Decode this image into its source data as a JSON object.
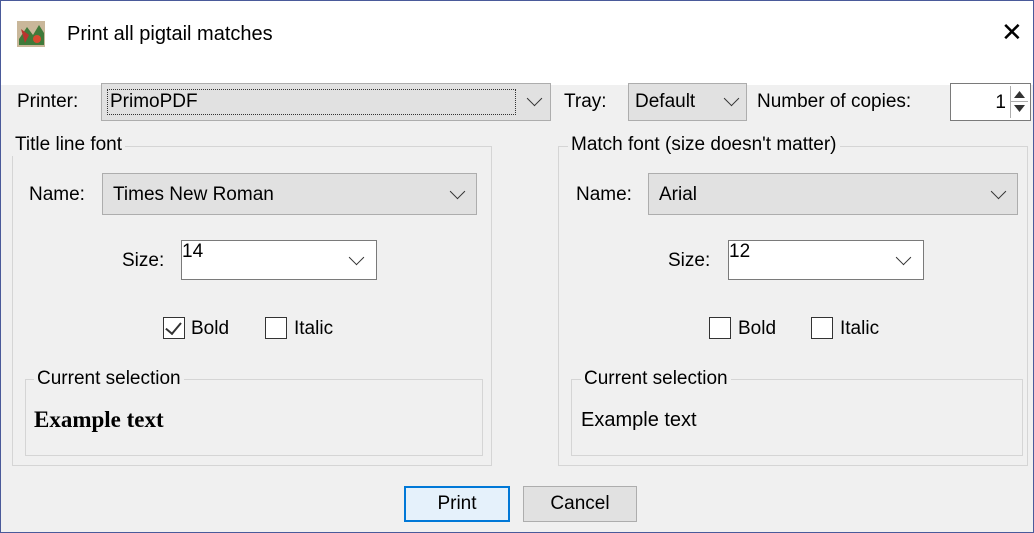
{
  "window": {
    "title": "Print all pigtail matches"
  },
  "printer": {
    "label": "Printer:",
    "value": "PrimoPDF",
    "tray_label": "Tray:",
    "tray_value": "Default",
    "copies_label": "Number of copies:",
    "copies_value": "1"
  },
  "title_font": {
    "legend": "Title line font",
    "name_label": "Name:",
    "name_value": "Times New Roman",
    "size_label": "Size:",
    "size_value": "14",
    "bold_label": "Bold",
    "bold_checked": true,
    "italic_label": "Italic",
    "italic_checked": false,
    "selection_legend": "Current selection",
    "example": "Example text"
  },
  "match_font": {
    "legend": "Match font (size doesn't matter)",
    "name_label": "Name:",
    "name_value": "Arial",
    "size_label": "Size:",
    "size_value": "12",
    "bold_label": "Bold",
    "bold_checked": false,
    "italic_label": "Italic",
    "italic_checked": false,
    "selection_legend": "Current selection",
    "example": "Example text"
  },
  "buttons": {
    "print": "Print",
    "cancel": "Cancel"
  }
}
